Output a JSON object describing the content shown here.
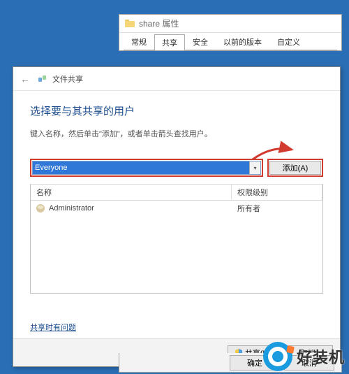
{
  "props": {
    "title": "share 属性",
    "tabs": [
      "常规",
      "共享",
      "安全",
      "以前的版本",
      "自定义"
    ],
    "activeTabIndex": 1,
    "buttons": {
      "ok": "确定",
      "cancel": "取消"
    }
  },
  "share": {
    "header": "文件共享",
    "heading": "选择要与其共享的用户",
    "sub": "键入名称，然后单击\"添加\"，或者单击箭头查找用户。",
    "combo_value": "Everyone",
    "add_label": "添加(A)",
    "columns": {
      "name": "名称",
      "perm": "权限级别"
    },
    "rows": [
      {
        "name": "Administrator",
        "perm": "所有者"
      }
    ],
    "trouble_link": "共享时有问题",
    "footer": {
      "share": "共享(H)",
      "cancel": "取消"
    }
  },
  "watermark": "好装机"
}
